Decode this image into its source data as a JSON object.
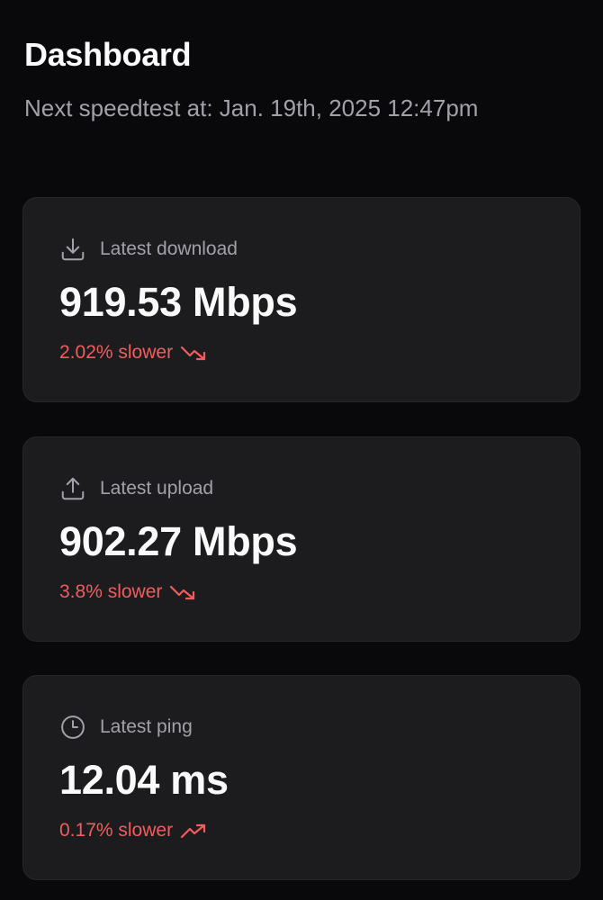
{
  "header": {
    "title": "Dashboard",
    "next_speedtest": "Next speedtest at: Jan. 19th, 2025 12:47pm"
  },
  "colors": {
    "background": "#09090b",
    "card": "#1c1c1f",
    "muted_text": "#a1a1aa",
    "negative": "#f25c5c"
  },
  "cards": [
    {
      "icon": "download-icon",
      "label": "Latest download",
      "value": "919.53 Mbps",
      "change": "2.02% slower",
      "trend_icon": "trending-down-icon"
    },
    {
      "icon": "upload-icon",
      "label": "Latest upload",
      "value": "902.27 Mbps",
      "change": "3.8% slower",
      "trend_icon": "trending-down-icon"
    },
    {
      "icon": "clock-icon",
      "label": "Latest ping",
      "value": "12.04 ms",
      "change": "0.17% slower",
      "trend_icon": "trending-up-icon"
    }
  ]
}
